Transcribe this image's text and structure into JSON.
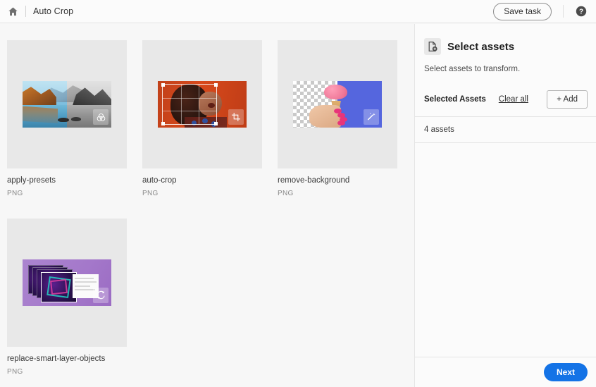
{
  "header": {
    "home_icon": "home-icon",
    "title": "Auto Crop",
    "save_task_label": "Save task",
    "help_icon": "help-icon"
  },
  "assets": [
    {
      "name": "apply-presets",
      "type": "PNG",
      "badge_icon": "presets-badge-icon"
    },
    {
      "name": "auto-crop",
      "type": "PNG",
      "badge_icon": "crop-badge-icon"
    },
    {
      "name": "remove-background",
      "type": "PNG",
      "badge_icon": "magic-wand-badge-icon"
    },
    {
      "name": "replace-smart-layer-objects",
      "type": "PNG",
      "badge_icon": "refresh-badge-icon"
    }
  ],
  "sidebar": {
    "panel_icon": "select-assets-icon",
    "title": "Select assets",
    "subtitle": "Select assets to transform.",
    "selected_label": "Selected Assets",
    "clear_all_label": "Clear all",
    "add_label": "+ Add",
    "count_label": "4 assets",
    "next_label": "Next"
  },
  "colors": {
    "accent": "#1473e6",
    "page_bg": "#f7f7f7",
    "card_bg": "#e8e8e8",
    "panel_bg": "#fbfbfb",
    "border": "#e4e4e4"
  }
}
